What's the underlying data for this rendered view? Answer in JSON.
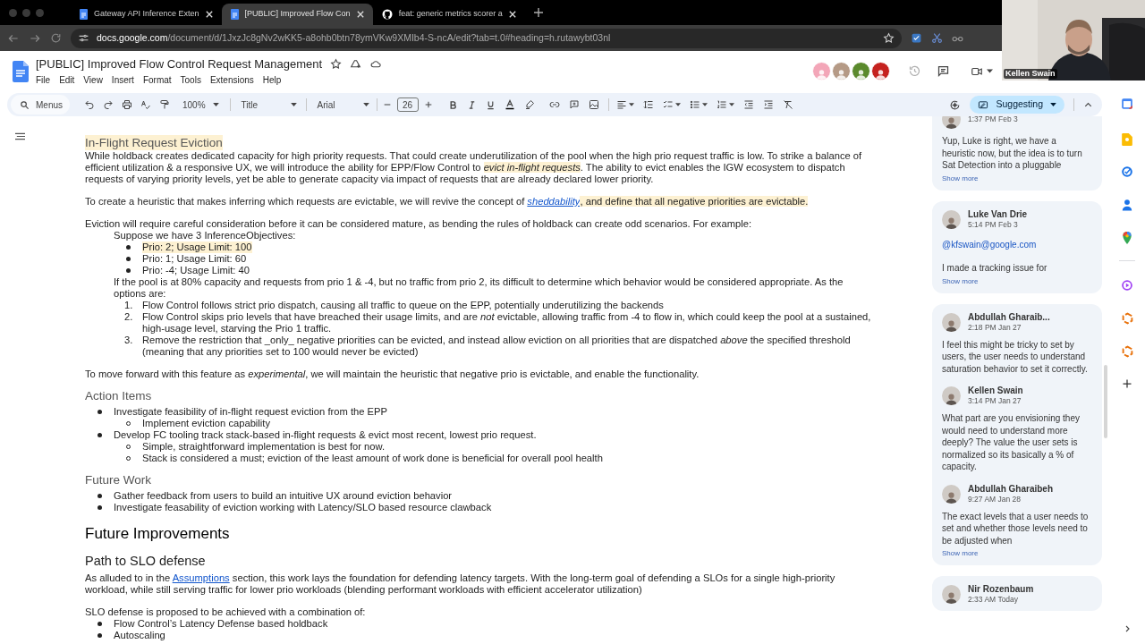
{
  "browser": {
    "tabs": [
      {
        "title": "Gateway API Inference Exten",
        "selected": false
      },
      {
        "title": "[PUBLIC] Improved Flow Con",
        "selected": true
      },
      {
        "title": "feat: generic metrics scorer a",
        "selected": false
      }
    ],
    "url_host": "docs.google.com",
    "url_path": "/document/d/1JxzJc8gNv2wKK5-a8ohb0btn78ymVKw9XMIb4-S-ncA/edit?tab=t.0#heading=h.rutawybt03nl"
  },
  "document": {
    "title": "[PUBLIC] Improved Flow Control Request Management",
    "menu": [
      "File",
      "Edit",
      "View",
      "Insert",
      "Format",
      "Tools",
      "Extensions",
      "Help"
    ],
    "collaborators": [
      {
        "color": "#f3a6b8"
      },
      {
        "color": "#b59a86"
      },
      {
        "color": "#5b8a2d"
      },
      {
        "color": "#c5221f"
      }
    ]
  },
  "toolbar": {
    "search": "Menus",
    "zoom": "100%",
    "style": "Title",
    "font": "Arial",
    "font_size": "26",
    "mode": "Suggesting"
  },
  "webcam": {
    "name": "Kellen Swain"
  },
  "body": [
    {
      "kind": "h3",
      "text": "In-Flight Request Eviction",
      "highlighted": true
    },
    {
      "kind": "paragraph",
      "parts": [
        {
          "kind": "text",
          "text": "While holdback creates dedicated capacity for high priority requests. That could create underutilization of the pool when the high prio request traffic is low. To strike a balance of efficient utilization & a responsive UX, we will introduce the ability for EPP/Flow Control to ",
          "highlighted": false
        },
        {
          "kind": "text",
          "text": "*evict in-flight requests*",
          "highlighted": true
        },
        {
          "kind": "text",
          "text": ". The ability to evict enables the IGW ecosystem to dispatch requests of varying priority levels, yet be able to generate capacity via impact of requests that are already declared lower priority.",
          "highlighted": false
        }
      ]
    },
    {
      "kind": "paragraph",
      "parts": [
        {
          "kind": "text",
          "text": "To create a heuristic that makes inferring which requests are evictable, we will revive the concept of ",
          "highlighted": false
        },
        {
          "kind": "link",
          "text": "*sheddability*",
          "highlighted": false
        },
        {
          "kind": "text",
          "text": ", and define that all negative priorities are evictable.",
          "highlighted": true
        }
      ]
    },
    {
      "kind": "paragraph",
      "parts": [
        {
          "kind": "text",
          "text": "Eviction will require careful consideration before it can be considered mature, as bending the rules of holdback can create odd scenarios. For example:",
          "highlighted": false
        }
      ]
    },
    {
      "kind": "indented",
      "children": [
        {
          "kind": "paragraph",
          "parts": [
            {
              "kind": "text",
              "text": "Suppose we have 3 InferenceObjectives:",
              "highlighted": false
            }
          ]
        },
        {
          "kind": "bullets",
          "items": [
            {
              "text": "Prio: 2; Usage Limit: 100",
              "highlighted": true
            },
            {
              "text": "Prio: 1; Usage Limit: 60",
              "highlighted": false
            },
            {
              "text": "Prio: -4; Usage Limit: 40",
              "highlighted": false
            }
          ]
        },
        {
          "kind": "paragraph",
          "parts": [
            {
              "kind": "text",
              "text": "If the pool is at 80% capacity and requests from prio 1 & -4, but no traffic from prio 2, its difficult to determine which behavior would be considered appropriate. As the options are:",
              "highlighted": false
            }
          ]
        },
        {
          "kind": "numbered",
          "items": [
            {
              "marker": "1.",
              "text": "Flow Control follows strict prio dispatch, causing all traffic to queue on the EPP, potentially underutilizing the backends",
              "highlighted": false
            },
            {
              "marker": "2.",
              "text": "Flow Control skips prio levels that have breached their usage limits, and are *not* evictable, allowing traffic from -4 to flow in, which could keep the pool at a sustained, high-usage level, starving the Prio 1 traffic.",
              "highlighted": false
            },
            {
              "marker": "3.",
              "text": "Remove the restriction that _only_ negative priorities can be evicted, and instead allow eviction on all priorities that are dispatched *above* the specified threshold (meaning that any priorities set to 100 would never be evicted)",
              "highlighted": false
            }
          ]
        }
      ]
    },
    {
      "kind": "paragraph",
      "parts": [
        {
          "kind": "text",
          "text": "To move forward with this feature as *experimental*, we will maintain the heuristic that negative prio is evictable, and enable the functionality.",
          "highlighted": false
        }
      ]
    },
    {
      "kind": "h3",
      "text": "Action Items",
      "highlighted": false
    },
    {
      "kind": "bullets",
      "items": [
        {
          "text": "Investigate feasibility of in-flight request eviction from the EPP",
          "highlighted": false,
          "children": [
            {
              "text": "Implement eviction capability",
              "highlighted": false
            }
          ]
        },
        {
          "text": "Develop FC tooling track stack-based in-flight requests & evict most recent, lowest prio request.",
          "highlighted": false,
          "children": [
            {
              "text": "Simple, straightforward implementation is best for now.",
              "highlighted": false
            },
            {
              "text": "Stack is considered a must; eviction of the least amount of work done is beneficial for overall pool health",
              "highlighted": false
            }
          ]
        }
      ]
    },
    {
      "kind": "h3",
      "text": "Future Work",
      "highlighted": false
    },
    {
      "kind": "bullets",
      "items": [
        {
          "text": "Gather feedback from users to build an intuitive UX around eviction behavior",
          "highlighted": false
        },
        {
          "text": "Investigate feasability of eviction working with Latency/SLO based resource clawback",
          "highlighted": false
        }
      ]
    },
    {
      "kind": "h1",
      "text": "Future Improvements"
    },
    {
      "kind": "h2",
      "text": "Path to SLO defense"
    },
    {
      "kind": "paragraph",
      "parts": [
        {
          "kind": "text",
          "text": "As alluded to in the ",
          "highlighted": false
        },
        {
          "kind": "link",
          "text": "Assumptions",
          "highlighted": false
        },
        {
          "kind": "text",
          "text": " section, this work lays the foundation for defending latency targets. With the long-term goal of defending a SLOs for a single high-priority workload, while still serving traffic for lower prio workloads (blending performant workloads with efficient accelerator utilization)",
          "highlighted": false
        }
      ]
    },
    {
      "kind": "paragraph",
      "parts": [
        {
          "kind": "text",
          "text": "SLO defense is proposed to be achieved with a combination of:",
          "highlighted": false
        }
      ]
    },
    {
      "kind": "bullets",
      "items": [
        {
          "text": "Flow Control’s Latency Defense based holdback",
          "highlighted": false
        },
        {
          "text": "Autoscaling",
          "highlighted": false
        }
      ]
    }
  ],
  "comments": [
    {
      "entries": [
        {
          "time": "1:37 PM Feb 3",
          "text": "Yup, Luke is right, we have a heuristic now, but the idea is to turn Sat Detection into a pluggable"
        }
      ],
      "show_more": "Show more"
    },
    {
      "entries": [
        {
          "author": "Luke Van Drie",
          "time": "5:14 PM Feb 3",
          "mention": "@kfswain@google.com",
          "text": "I made a tracking issue for"
        }
      ],
      "show_more": "Show more"
    },
    {
      "entries": [
        {
          "author": "Abdullah Gharaib...",
          "time": "2:18 PM Jan 27",
          "text": "I feel this might be tricky to set by users, the user needs to understand saturation behavior to set it correctly."
        },
        {
          "author": "Kellen Swain",
          "time": "3:14 PM Jan 27",
          "text": "What part are you envisioning they would need to understand more deeply? The value the user sets is normalized so its basically a % of capacity."
        },
        {
          "author": "Abdullah Gharaibeh",
          "time": "9:27 AM Jan 28",
          "text": "The exact levels that a user needs to set and whether those levels need to be adjusted when"
        }
      ],
      "show_more": "Show more"
    },
    {
      "entries": [
        {
          "author": "Nir Rozenbaum",
          "time": "2:33 AM Today"
        }
      ]
    }
  ]
}
